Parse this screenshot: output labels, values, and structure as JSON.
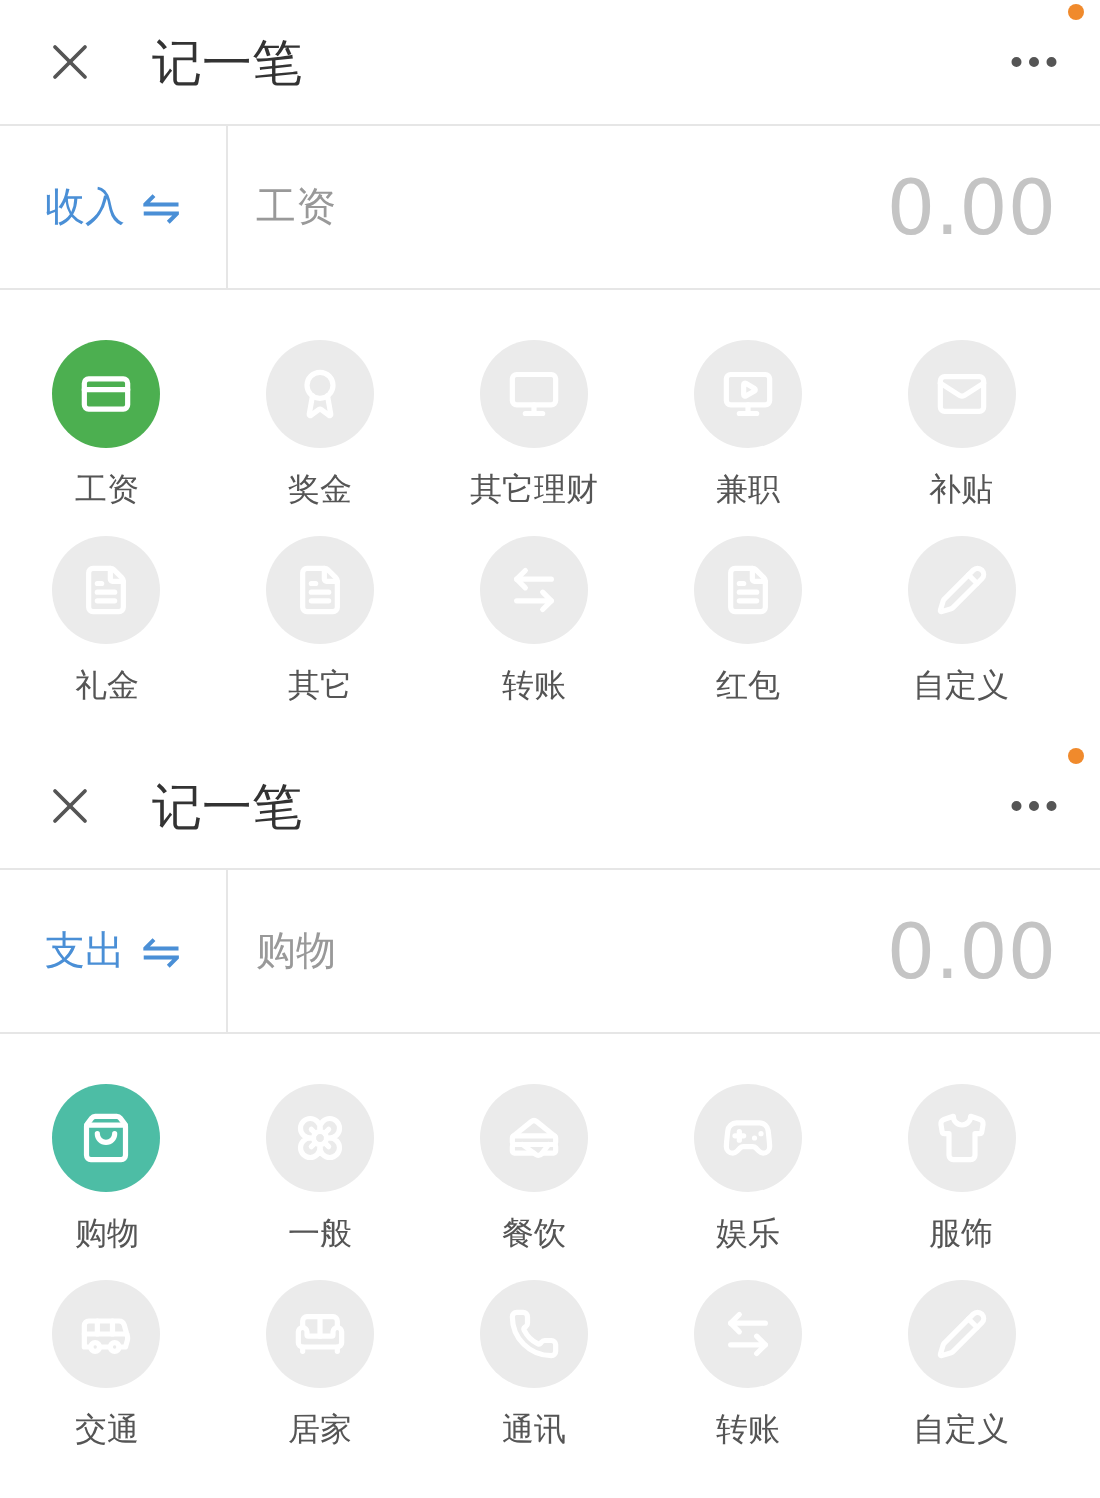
{
  "panels": [
    {
      "header": {
        "title": "记一笔",
        "has_notification": true
      },
      "type_toggle": {
        "label": "收入",
        "symbol": "⇋"
      },
      "category": "工资",
      "amount": "0.00",
      "categories": [
        {
          "label": "工资",
          "selected": true,
          "color": "#4caf50"
        },
        {
          "label": "奖金",
          "selected": false
        },
        {
          "label": "其它理财",
          "selected": false
        },
        {
          "label": "兼职",
          "selected": false
        },
        {
          "label": "补贴",
          "selected": false
        },
        {
          "label": "礼金",
          "selected": false
        },
        {
          "label": "其它",
          "selected": false
        },
        {
          "label": "转账",
          "selected": false
        },
        {
          "label": "红包",
          "selected": false
        },
        {
          "label": "自定义",
          "selected": false
        }
      ]
    },
    {
      "header": {
        "title": "记一笔",
        "has_notification": true
      },
      "type_toggle": {
        "label": "支出",
        "symbol": "⇋"
      },
      "category": "购物",
      "amount": "0.00",
      "categories": [
        {
          "label": "购物",
          "selected": true,
          "color": "#4dbda5"
        },
        {
          "label": "一般",
          "selected": false
        },
        {
          "label": "餐饮",
          "selected": false
        },
        {
          "label": "娱乐",
          "selected": false
        },
        {
          "label": "服饰",
          "selected": false
        },
        {
          "label": "交通",
          "selected": false
        },
        {
          "label": "居家",
          "selected": false
        },
        {
          "label": "通讯",
          "selected": false
        },
        {
          "label": "转账",
          "selected": false
        },
        {
          "label": "自定义",
          "selected": false
        }
      ]
    }
  ]
}
